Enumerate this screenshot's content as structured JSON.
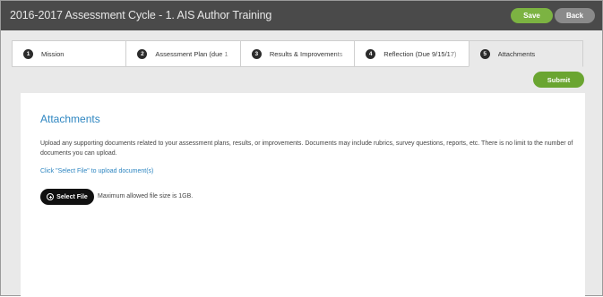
{
  "window": {
    "title": "2016-2017 Assessment Cycle - 1. AIS Author Training"
  },
  "header_buttons": {
    "save_label": "Save",
    "back_label": "Back"
  },
  "tabs": [
    {
      "number": "1",
      "label": "Mission",
      "active": false
    },
    {
      "number": "2",
      "label": "Assessment Plan (due 1",
      "active": false
    },
    {
      "number": "3",
      "label": "Results & Improvements",
      "active": false
    },
    {
      "number": "4",
      "label": "Reflection (Due 9/15/17)",
      "active": false
    },
    {
      "number": "5",
      "label": "Attachments",
      "active": true
    }
  ],
  "submit_label": "Submit",
  "attachments": {
    "title": "Attachments",
    "description": "Upload any supporting documents related to your assessment plans, results, or improvements. Documents may include rubrics, survey questions, reports, etc. There is no limit to the number of documents you can upload.",
    "instruction": "Click \"Select File\" to upload document(s)",
    "select_file_label": "Select File",
    "max_size_text": "Maximum allowed file size is 1GB."
  },
  "colors": {
    "titlebar": "#4a4a4a",
    "save_button": "#7cb342",
    "back_button": "#8a8a8a",
    "submit_button": "#6aa531",
    "heading_link": "#2e86c1"
  },
  "icons": {
    "tab_step_marker": "numbered-circle",
    "select_file": "plus-circle-icon"
  }
}
